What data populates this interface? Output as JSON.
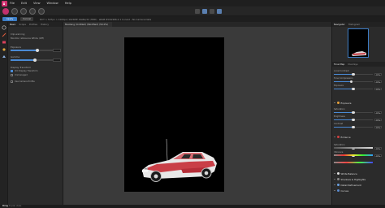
{
  "menu": [
    "File",
    "Edit",
    "View",
    "Window",
    "Help"
  ],
  "context": {
    "apply_label": "Apply",
    "cancel_label": "Cancel",
    "info": "DCT > 507px > 1024px (1024MP, RGBA/32 (HDR) - sRGB IEC61966-2.1 Curved - No Camera Data"
  },
  "left_panel": {
    "tabs": [
      "Basic",
      "Scope",
      "Profiles",
      "History"
    ],
    "label_clip": "Clip warning",
    "label_white_balance": "Monitor reference White (Off)",
    "label_exposure": "Exposure",
    "label_gamma": "Gamma",
    "label_display": "Display Transform",
    "opt_1": "ICC Display Transform",
    "opt_2": "Unmanaged",
    "opt_3": "Use Camera Profile",
    "exposure_value": 0.55,
    "gamma_value": 0.5
  },
  "document_tab": "Mustang (Untitled) (Modified) (50.0%)",
  "right_panel": {
    "tabs": [
      "Navigator",
      "Histogram"
    ],
    "sub_tabs": [
      "Tone Map",
      "Overlays"
    ],
    "rows": [
      {
        "label": "Local Contrast",
        "value": "0 %",
        "fill": 0.5
      },
      {
        "label": "Tone Compression",
        "value": "0 %",
        "fill": 0.45
      },
      {
        "label": "Exposure",
        "value": "0 %",
        "fill": 0.5
      },
      {
        "label": "Saturation",
        "value": "0 %",
        "fill": 0.5
      },
      {
        "label": "Brightness",
        "value": "0 %",
        "fill": 0.5
      },
      {
        "label": "Contrast",
        "value": "0 %",
        "fill": 0.5
      },
      {
        "label": "Saturation",
        "value": "0 %",
        "fill": 0.5
      },
      {
        "label": "Vibrance",
        "value": "0 %",
        "fill": 0.5
      }
    ],
    "sections": [
      "Exposure",
      "Enhance",
      "White Balance",
      "Shadows & Highlights",
      "Detail Refinement",
      "Curves"
    ]
  },
  "status_text_bold": "Drag",
  "status_text": " to pan view."
}
